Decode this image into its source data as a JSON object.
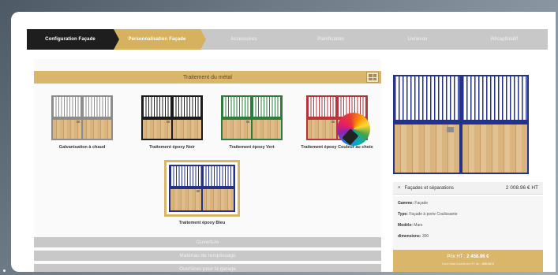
{
  "stepper": {
    "steps": [
      "Configuration Façade",
      "Personnalisation Façade",
      "Accessoires",
      "Planification",
      "Livraison",
      "Récapitulatif"
    ]
  },
  "treatment": {
    "title": "Traitement du métal",
    "options": [
      {
        "label": "Galvanisation à chaud",
        "color": "#8c8c8c"
      },
      {
        "label": "Traitement époxy Noir",
        "color": "#1b1b1b"
      },
      {
        "label": "Traitement époxy Vert",
        "color": "#2f7a3d"
      },
      {
        "label": "Traitement époxy Couleur au choix",
        "color": "#b5353a"
      },
      {
        "label": "Traitement époxy Bleu",
        "color": "#24328a",
        "selected": true
      }
    ]
  },
  "accordions": [
    "Ouverture",
    "Matériau de remplissage",
    "Ouvrières pour la garage"
  ],
  "summary": {
    "heading": "Façades et séparations",
    "heading_price": "2 008.96 € HT",
    "details": [
      {
        "key": "Gamme:",
        "value": " Façade"
      },
      {
        "key": "Type:",
        "value": " Façade à porte Coulissante"
      },
      {
        "key": "Modèle:",
        "value": " Mars"
      },
      {
        "key": "dimensions:",
        "value": " 300"
      }
    ],
    "price_label": "Prix HT : ",
    "price_value": "2 458.96 €",
    "sub_label": "Dont total fourniture HT de : ",
    "sub_value": "490.00 €"
  }
}
